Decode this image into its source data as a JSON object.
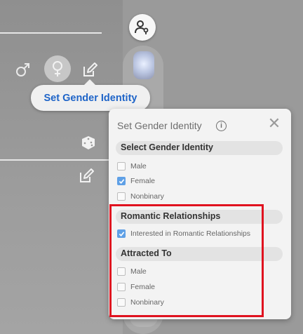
{
  "left_panel": {
    "tooltip_text": "Set Gender Identity"
  },
  "settings_panel": {
    "title": "Set Gender Identity",
    "sections": [
      {
        "title": "Select Gender Identity",
        "options": [
          {
            "label": "Male",
            "checked": false
          },
          {
            "label": "Female",
            "checked": true
          },
          {
            "label": "Nonbinary",
            "checked": false
          }
        ]
      },
      {
        "title": "Romantic Relationships",
        "options": [
          {
            "label": "Interested in Romantic Relationships",
            "checked": true
          }
        ]
      },
      {
        "title": "Attracted To",
        "options": [
          {
            "label": "Male",
            "checked": false
          },
          {
            "label": "Female",
            "checked": false
          },
          {
            "label": "Nonbinary",
            "checked": false
          }
        ]
      }
    ]
  },
  "colors": {
    "accent_blue": "#1e64c8",
    "checkbox_blue": "#5fa0e6",
    "highlight_red": "#e0121f"
  }
}
